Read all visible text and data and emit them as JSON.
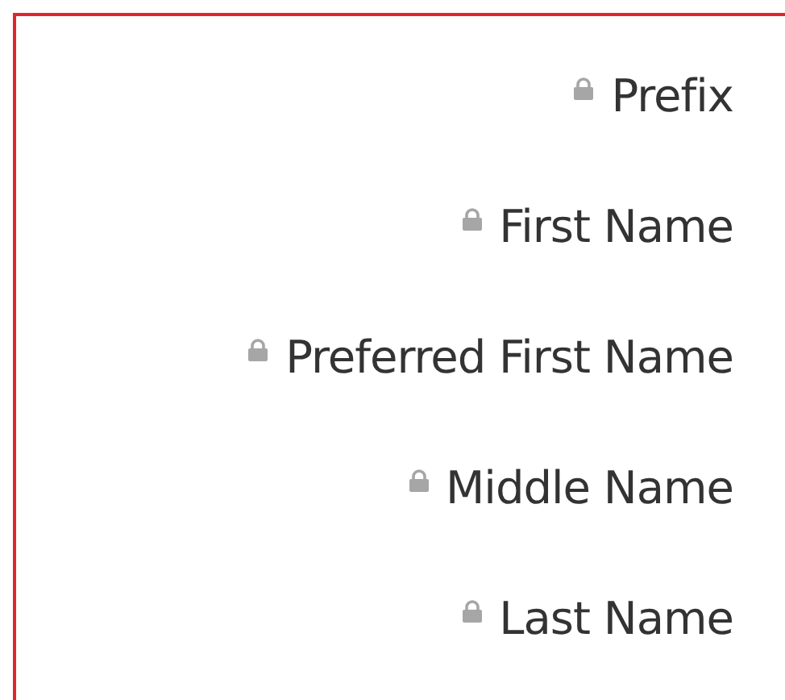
{
  "fields": [
    {
      "label": "Prefix",
      "locked": true
    },
    {
      "label": "First Name",
      "locked": true
    },
    {
      "label": "Preferred First Name",
      "locked": true
    },
    {
      "label": "Middle Name",
      "locked": true
    },
    {
      "label": "Last Name",
      "locked": true
    }
  ]
}
